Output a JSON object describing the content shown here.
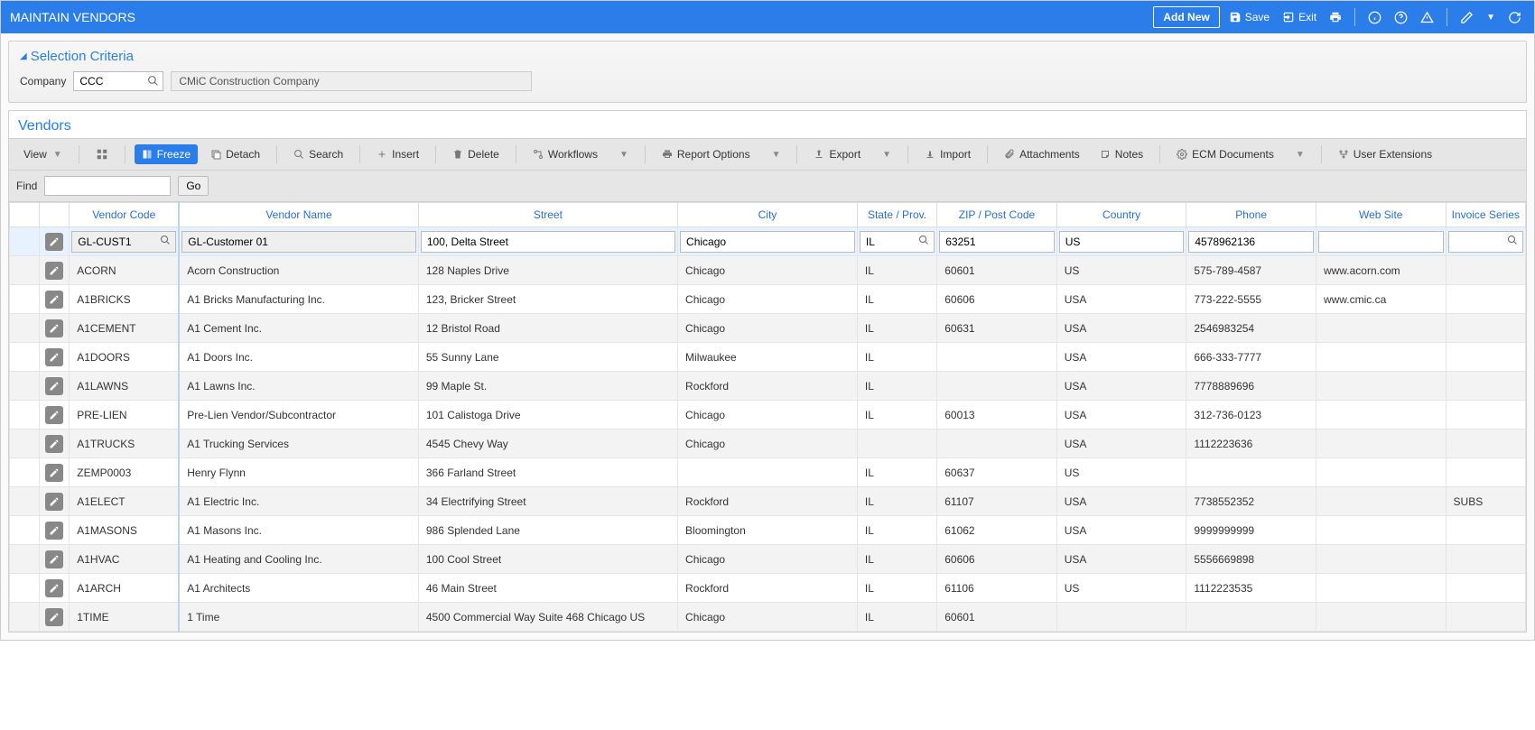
{
  "topbar": {
    "title": "MAINTAIN VENDORS",
    "add_new": "Add New",
    "save": "Save",
    "exit": "Exit"
  },
  "selection": {
    "header": "Selection Criteria",
    "company_label": "Company",
    "company_code": "CCC",
    "company_name": "CMiC Construction Company"
  },
  "vendors_section_title": "Vendors",
  "toolbar": {
    "view": "View",
    "freeze": "Freeze",
    "detach": "Detach",
    "search": "Search",
    "insert": "Insert",
    "delete": "Delete",
    "workflows": "Workflows",
    "report_options": "Report Options",
    "export": "Export",
    "import": "Import",
    "attachments": "Attachments",
    "notes": "Notes",
    "ecm_documents": "ECM Documents",
    "user_extensions": "User Extensions"
  },
  "find": {
    "label": "Find",
    "go": "Go",
    "value": ""
  },
  "columns": {
    "vendor_code": "Vendor Code",
    "vendor_name": "Vendor Name",
    "street": "Street",
    "city": "City",
    "state": "State / Prov.",
    "zip": "ZIP / Post Code",
    "country": "Country",
    "phone": "Phone",
    "website": "Web Site",
    "invoice_series": "Invoice Series"
  },
  "selected_row": {
    "vendor_code": "GL-CUST1",
    "vendor_name": "GL-Customer 01",
    "street": "100, Delta Street",
    "city": "Chicago",
    "state": "IL",
    "zip": "63251",
    "country": "US",
    "phone": "4578962136",
    "website": "",
    "invoice_series": ""
  },
  "rows": [
    {
      "vendor_code": "ACORN",
      "vendor_name": "Acorn Construction",
      "street": "128 Naples Drive",
      "city": "Chicago",
      "state": "IL",
      "zip": "60601",
      "country": "US",
      "phone": "575-789-4587",
      "website": "www.acorn.com",
      "invoice_series": ""
    },
    {
      "vendor_code": "A1BRICKS",
      "vendor_name": "A1 Bricks Manufacturing Inc.",
      "street": "123, Bricker Street",
      "city": "Chicago",
      "state": "IL",
      "zip": "60606",
      "country": "USA",
      "phone": "773-222-5555",
      "website": "www.cmic.ca",
      "invoice_series": ""
    },
    {
      "vendor_code": "A1CEMENT",
      "vendor_name": "A1 Cement Inc.",
      "street": "12 Bristol Road",
      "city": "Chicago",
      "state": "IL",
      "zip": "60631",
      "country": "USA",
      "phone": "2546983254",
      "website": "",
      "invoice_series": ""
    },
    {
      "vendor_code": "A1DOORS",
      "vendor_name": "A1 Doors Inc.",
      "street": "55 Sunny Lane",
      "city": "Milwaukee",
      "state": "IL",
      "zip": "",
      "country": "USA",
      "phone": "666-333-7777",
      "website": "",
      "invoice_series": ""
    },
    {
      "vendor_code": "A1LAWNS",
      "vendor_name": "A1 Lawns Inc.",
      "street": "99 Maple St.",
      "city": "Rockford",
      "state": "IL",
      "zip": "",
      "country": "USA",
      "phone": "7778889696",
      "website": "",
      "invoice_series": ""
    },
    {
      "vendor_code": "PRE-LIEN",
      "vendor_name": "Pre-Lien Vendor/Subcontractor",
      "street": "101 Calistoga Drive",
      "city": "Chicago",
      "state": "IL",
      "zip": "60013",
      "country": "USA",
      "phone": "312-736-0123",
      "website": "",
      "invoice_series": ""
    },
    {
      "vendor_code": "A1TRUCKS",
      "vendor_name": "A1 Trucking Services",
      "street": "4545 Chevy Way",
      "city": "Chicago",
      "state": "",
      "zip": "",
      "country": "USA",
      "phone": "1112223636",
      "website": "",
      "invoice_series": ""
    },
    {
      "vendor_code": "ZEMP0003",
      "vendor_name": "Henry Flynn",
      "street": "366 Farland Street",
      "city": "",
      "state": "IL",
      "zip": "60637",
      "country": "US",
      "phone": "",
      "website": "",
      "invoice_series": ""
    },
    {
      "vendor_code": "A1ELECT",
      "vendor_name": "A1 Electric Inc.",
      "street": "34 Electrifying Street",
      "city": "Rockford",
      "state": "IL",
      "zip": "61107",
      "country": "USA",
      "phone": "7738552352",
      "website": "",
      "invoice_series": "SUBS"
    },
    {
      "vendor_code": "A1MASONS",
      "vendor_name": "A1 Masons Inc.",
      "street": "986 Splended Lane",
      "city": "Bloomington",
      "state": "IL",
      "zip": "61062",
      "country": "USA",
      "phone": "9999999999",
      "website": "",
      "invoice_series": ""
    },
    {
      "vendor_code": "A1HVAC",
      "vendor_name": "A1 Heating and Cooling Inc.",
      "street": "100 Cool Street",
      "city": "Chicago",
      "state": "IL",
      "zip": "60606",
      "country": "USA",
      "phone": "5556669898",
      "website": "",
      "invoice_series": ""
    },
    {
      "vendor_code": "A1ARCH",
      "vendor_name": "A1 Architects",
      "street": "46 Main Street",
      "city": "Rockford",
      "state": "IL",
      "zip": "61106",
      "country": "US",
      "phone": "1112223535",
      "website": "",
      "invoice_series": ""
    },
    {
      "vendor_code": "1TIME",
      "vendor_name": "1 Time",
      "street": "4500 Commercial Way Suite 468 Chicago US",
      "city": "Chicago",
      "state": "IL",
      "zip": "60601",
      "country": "",
      "phone": "",
      "website": "",
      "invoice_series": ""
    }
  ]
}
